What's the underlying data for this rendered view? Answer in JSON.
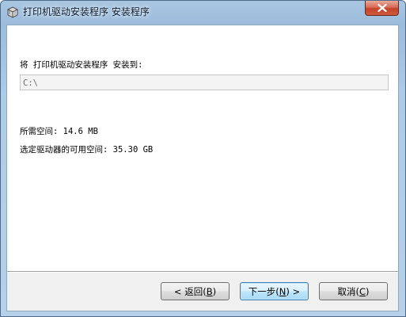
{
  "window": {
    "title": "打印机驱动安装程序 安装程序"
  },
  "install": {
    "prompt": "将 打印机驱动安装程序 安装到:",
    "path_value": "C:\\",
    "required_space_label": "所需空间:",
    "required_space_value": "14.6 MB",
    "available_space_label": "选定驱动器的可用空间:",
    "available_space_value": "35.30 GB"
  },
  "buttons": {
    "back": {
      "prefix": "< 返回(",
      "key": "B",
      "suffix": ")"
    },
    "next": {
      "prefix": "下一步(",
      "key": "N",
      "suffix": ") >"
    },
    "cancel": {
      "prefix": "取消(",
      "key": "C",
      "suffix": ")"
    }
  },
  "colors": {
    "frame": "#a9c6e1",
    "close_button": "#c3422a",
    "default_button_border": "#3c7fb1"
  },
  "icons": {
    "app": "installer-box-icon",
    "close": "close-x-icon"
  }
}
